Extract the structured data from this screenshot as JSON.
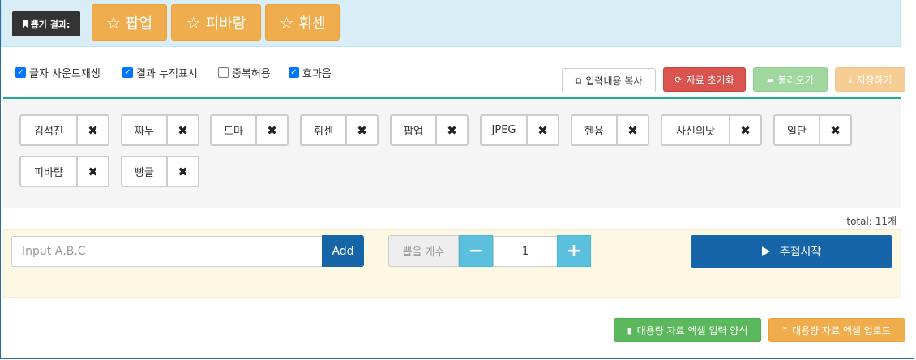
{
  "result": {
    "label": "뽑기 결과:",
    "winners": [
      "팝업",
      "피바람",
      "휘센"
    ]
  },
  "options": [
    {
      "label": "글자 사운드재생",
      "checked": true
    },
    {
      "label": "결과 누적표시",
      "checked": true
    },
    {
      "label": "중복허용",
      "checked": false
    },
    {
      "label": "효과음",
      "checked": true
    }
  ],
  "toolbar": {
    "copy_label": "입력내용 복사",
    "reset_label": "자료 초기화",
    "load_label": "불러오기",
    "save_label": "저장하기"
  },
  "items": [
    "김석진",
    "짜누",
    "드마",
    "휘센",
    "팝업",
    "JPEG",
    "헨윰",
    "사신의낫",
    "일단",
    "피바람",
    "빵글"
  ],
  "total_label": "total: 11개",
  "input": {
    "placeholder": "Input A,B,C",
    "add_label": "Add",
    "count_label": "뽑을 개수",
    "count_value": "1",
    "minus": "−",
    "plus": "+",
    "start_label": "추첨시작"
  },
  "excel": {
    "form_label": "대용량 자료 엑셀 입력 양식",
    "upload_label": "대용량 자료 엑셀 업로드"
  }
}
